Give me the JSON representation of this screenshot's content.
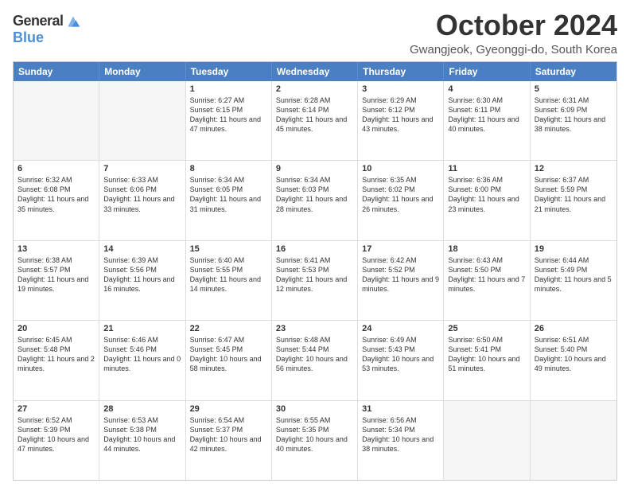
{
  "logo": {
    "general": "General",
    "blue": "Blue"
  },
  "header": {
    "month_title": "October 2024",
    "subtitle": "Gwangjeok, Gyeonggi-do, South Korea"
  },
  "weekdays": [
    "Sunday",
    "Monday",
    "Tuesday",
    "Wednesday",
    "Thursday",
    "Friday",
    "Saturday"
  ],
  "rows": [
    [
      {
        "day": "",
        "sunrise": "",
        "sunset": "",
        "daylight": "",
        "empty": true
      },
      {
        "day": "",
        "sunrise": "",
        "sunset": "",
        "daylight": "",
        "empty": true
      },
      {
        "day": "1",
        "sunrise": "Sunrise: 6:27 AM",
        "sunset": "Sunset: 6:15 PM",
        "daylight": "Daylight: 11 hours and 47 minutes."
      },
      {
        "day": "2",
        "sunrise": "Sunrise: 6:28 AM",
        "sunset": "Sunset: 6:14 PM",
        "daylight": "Daylight: 11 hours and 45 minutes."
      },
      {
        "day": "3",
        "sunrise": "Sunrise: 6:29 AM",
        "sunset": "Sunset: 6:12 PM",
        "daylight": "Daylight: 11 hours and 43 minutes."
      },
      {
        "day": "4",
        "sunrise": "Sunrise: 6:30 AM",
        "sunset": "Sunset: 6:11 PM",
        "daylight": "Daylight: 11 hours and 40 minutes."
      },
      {
        "day": "5",
        "sunrise": "Sunrise: 6:31 AM",
        "sunset": "Sunset: 6:09 PM",
        "daylight": "Daylight: 11 hours and 38 minutes."
      }
    ],
    [
      {
        "day": "6",
        "sunrise": "Sunrise: 6:32 AM",
        "sunset": "Sunset: 6:08 PM",
        "daylight": "Daylight: 11 hours and 35 minutes."
      },
      {
        "day": "7",
        "sunrise": "Sunrise: 6:33 AM",
        "sunset": "Sunset: 6:06 PM",
        "daylight": "Daylight: 11 hours and 33 minutes."
      },
      {
        "day": "8",
        "sunrise": "Sunrise: 6:34 AM",
        "sunset": "Sunset: 6:05 PM",
        "daylight": "Daylight: 11 hours and 31 minutes."
      },
      {
        "day": "9",
        "sunrise": "Sunrise: 6:34 AM",
        "sunset": "Sunset: 6:03 PM",
        "daylight": "Daylight: 11 hours and 28 minutes."
      },
      {
        "day": "10",
        "sunrise": "Sunrise: 6:35 AM",
        "sunset": "Sunset: 6:02 PM",
        "daylight": "Daylight: 11 hours and 26 minutes."
      },
      {
        "day": "11",
        "sunrise": "Sunrise: 6:36 AM",
        "sunset": "Sunset: 6:00 PM",
        "daylight": "Daylight: 11 hours and 23 minutes."
      },
      {
        "day": "12",
        "sunrise": "Sunrise: 6:37 AM",
        "sunset": "Sunset: 5:59 PM",
        "daylight": "Daylight: 11 hours and 21 minutes."
      }
    ],
    [
      {
        "day": "13",
        "sunrise": "Sunrise: 6:38 AM",
        "sunset": "Sunset: 5:57 PM",
        "daylight": "Daylight: 11 hours and 19 minutes."
      },
      {
        "day": "14",
        "sunrise": "Sunrise: 6:39 AM",
        "sunset": "Sunset: 5:56 PM",
        "daylight": "Daylight: 11 hours and 16 minutes."
      },
      {
        "day": "15",
        "sunrise": "Sunrise: 6:40 AM",
        "sunset": "Sunset: 5:55 PM",
        "daylight": "Daylight: 11 hours and 14 minutes."
      },
      {
        "day": "16",
        "sunrise": "Sunrise: 6:41 AM",
        "sunset": "Sunset: 5:53 PM",
        "daylight": "Daylight: 11 hours and 12 minutes."
      },
      {
        "day": "17",
        "sunrise": "Sunrise: 6:42 AM",
        "sunset": "Sunset: 5:52 PM",
        "daylight": "Daylight: 11 hours and 9 minutes."
      },
      {
        "day": "18",
        "sunrise": "Sunrise: 6:43 AM",
        "sunset": "Sunset: 5:50 PM",
        "daylight": "Daylight: 11 hours and 7 minutes."
      },
      {
        "day": "19",
        "sunrise": "Sunrise: 6:44 AM",
        "sunset": "Sunset: 5:49 PM",
        "daylight": "Daylight: 11 hours and 5 minutes."
      }
    ],
    [
      {
        "day": "20",
        "sunrise": "Sunrise: 6:45 AM",
        "sunset": "Sunset: 5:48 PM",
        "daylight": "Daylight: 11 hours and 2 minutes."
      },
      {
        "day": "21",
        "sunrise": "Sunrise: 6:46 AM",
        "sunset": "Sunset: 5:46 PM",
        "daylight": "Daylight: 11 hours and 0 minutes."
      },
      {
        "day": "22",
        "sunrise": "Sunrise: 6:47 AM",
        "sunset": "Sunset: 5:45 PM",
        "daylight": "Daylight: 10 hours and 58 minutes."
      },
      {
        "day": "23",
        "sunrise": "Sunrise: 6:48 AM",
        "sunset": "Sunset: 5:44 PM",
        "daylight": "Daylight: 10 hours and 56 minutes."
      },
      {
        "day": "24",
        "sunrise": "Sunrise: 6:49 AM",
        "sunset": "Sunset: 5:43 PM",
        "daylight": "Daylight: 10 hours and 53 minutes."
      },
      {
        "day": "25",
        "sunrise": "Sunrise: 6:50 AM",
        "sunset": "Sunset: 5:41 PM",
        "daylight": "Daylight: 10 hours and 51 minutes."
      },
      {
        "day": "26",
        "sunrise": "Sunrise: 6:51 AM",
        "sunset": "Sunset: 5:40 PM",
        "daylight": "Daylight: 10 hours and 49 minutes."
      }
    ],
    [
      {
        "day": "27",
        "sunrise": "Sunrise: 6:52 AM",
        "sunset": "Sunset: 5:39 PM",
        "daylight": "Daylight: 10 hours and 47 minutes."
      },
      {
        "day": "28",
        "sunrise": "Sunrise: 6:53 AM",
        "sunset": "Sunset: 5:38 PM",
        "daylight": "Daylight: 10 hours and 44 minutes."
      },
      {
        "day": "29",
        "sunrise": "Sunrise: 6:54 AM",
        "sunset": "Sunset: 5:37 PM",
        "daylight": "Daylight: 10 hours and 42 minutes."
      },
      {
        "day": "30",
        "sunrise": "Sunrise: 6:55 AM",
        "sunset": "Sunset: 5:35 PM",
        "daylight": "Daylight: 10 hours and 40 minutes."
      },
      {
        "day": "31",
        "sunrise": "Sunrise: 6:56 AM",
        "sunset": "Sunset: 5:34 PM",
        "daylight": "Daylight: 10 hours and 38 minutes."
      },
      {
        "day": "",
        "sunrise": "",
        "sunset": "",
        "daylight": "",
        "empty": true
      },
      {
        "day": "",
        "sunrise": "",
        "sunset": "",
        "daylight": "",
        "empty": true
      }
    ]
  ]
}
